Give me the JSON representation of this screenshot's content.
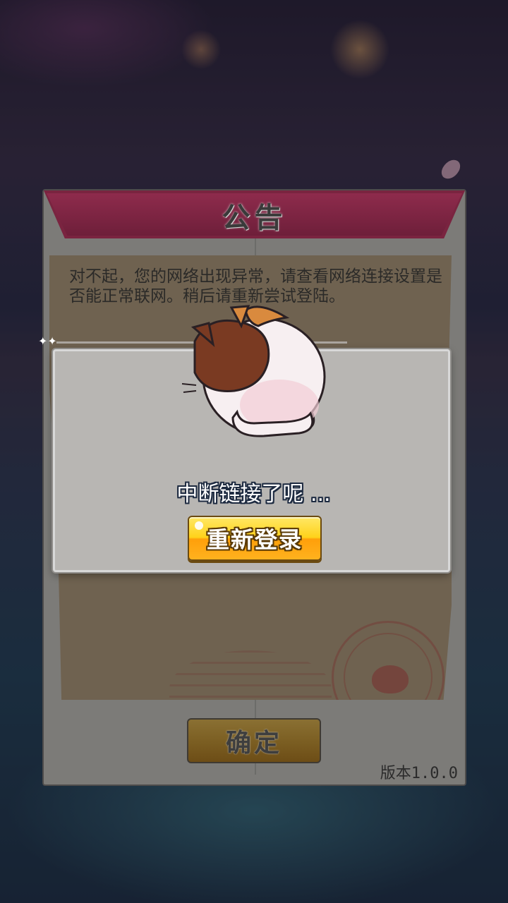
{
  "notice": {
    "title": "公告",
    "message": "对不起，您的网络出现异常，请查看网络连接设置是否能正常联网。稍后请重新尝试登陆。",
    "confirm_label": "确定",
    "version": "版本1.0.0"
  },
  "dialog": {
    "message": "中断链接了呢 ...",
    "relogin_label": "重新登录",
    "mascot": "sleeping-cat-icon"
  },
  "colors": {
    "banner": "#7a2440",
    "relogin_button": "#ffd21a",
    "dialog_bg": "#b8b6b3"
  }
}
